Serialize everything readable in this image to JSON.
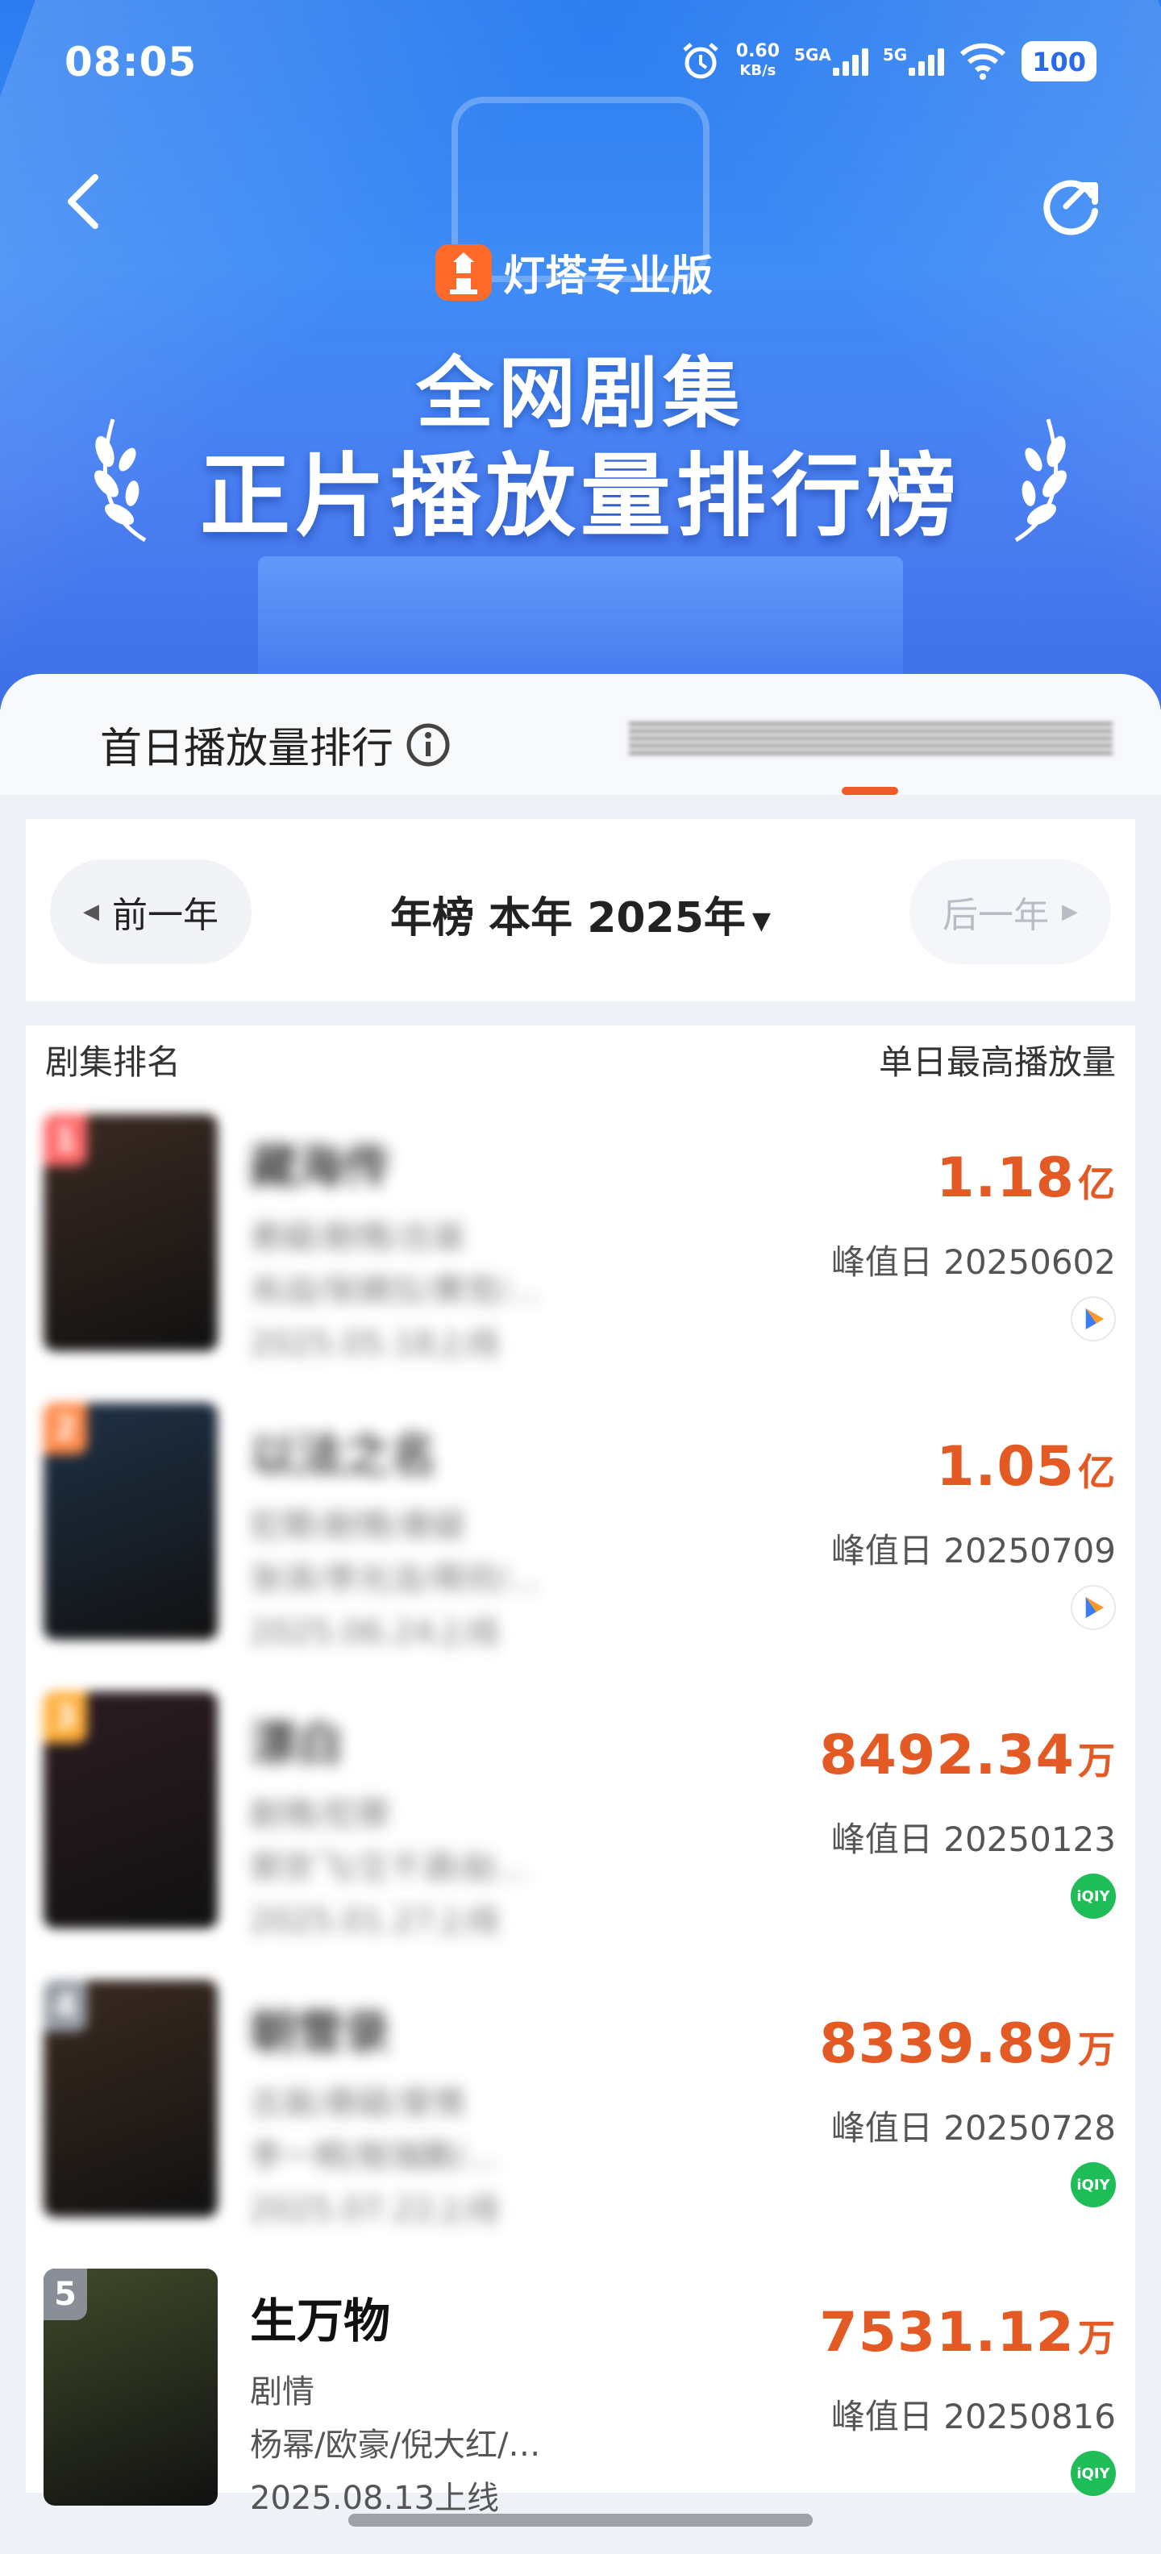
{
  "status_bar": {
    "time": "08:05",
    "net_speed": "0.60",
    "net_unit": "KB/s",
    "sig1": "5GA",
    "sig2": "5G",
    "battery": "100"
  },
  "banner": {
    "brand": "灯塔专业版",
    "title_line1": "全网剧集",
    "title_line2": "正片播放量排行榜"
  },
  "tabs": {
    "first": "首日播放量排行"
  },
  "year_nav": {
    "prev": "前一年",
    "title": "年榜 本年 2025年",
    "next": "后一年"
  },
  "list": {
    "col_left": "剧集排名",
    "col_right": "单日最高播放量",
    "peak_prefix": "峰值日",
    "items": [
      {
        "rank": "1",
        "name": "藏海传",
        "genre": "悬疑/剧情/古装",
        "cast": "肖战/张婧仪/黄觉/…",
        "release": "2025.05.18上线",
        "value": "1.18",
        "unit": "亿",
        "peak_date": "峰值日 20250602",
        "platform": "tencent-video-icon",
        "rank_color": "#ff6a6a",
        "poster_color": "#3b2a22"
      },
      {
        "rank": "2",
        "name": "以法之名",
        "genre": "犯罪/剧情/悬疑",
        "cast": "张译/李光洁/蒋欣/…",
        "release": "2025.06.24上线",
        "value": "1.05",
        "unit": "亿",
        "peak_date": "峰值日 20250709",
        "platform": "tencent-video-icon",
        "rank_color": "#ff8a4a",
        "poster_color": "#1f3146"
      },
      {
        "rank": "3",
        "name": "漂白",
        "genre": "剧情/犯罪",
        "cast": "郭京飞/王千源/赵…",
        "release": "2025.01.27上线",
        "value": "8492.34",
        "unit": "万",
        "peak_date": "峰值日 20250123",
        "platform": "iqiyi-icon",
        "rank_color": "#ffae3a",
        "poster_color": "#2b1c22"
      },
      {
        "rank": "4",
        "name": "朝雪录",
        "genre": "古装/悬疑/爱情",
        "cast": "李一桐/敖瑞鹏/…",
        "release": "2025.07.22上线",
        "value": "8339.89",
        "unit": "万",
        "peak_date": "峰值日 20250728",
        "platform": "iqiyi-icon",
        "rank_color": "#9aa0a8",
        "poster_color": "#3a2a20"
      },
      {
        "rank": "5",
        "name": "生万物",
        "genre": "剧情",
        "cast": "杨幂/欧豪/倪大红/…",
        "release": "2025.08.13上线",
        "value": "7531.12",
        "unit": "万",
        "peak_date": "峰值日 20250816",
        "platform": "iqiyi-icon",
        "rank_color": "#8a8e96",
        "poster_color": "#3f4a2a"
      }
    ]
  }
}
